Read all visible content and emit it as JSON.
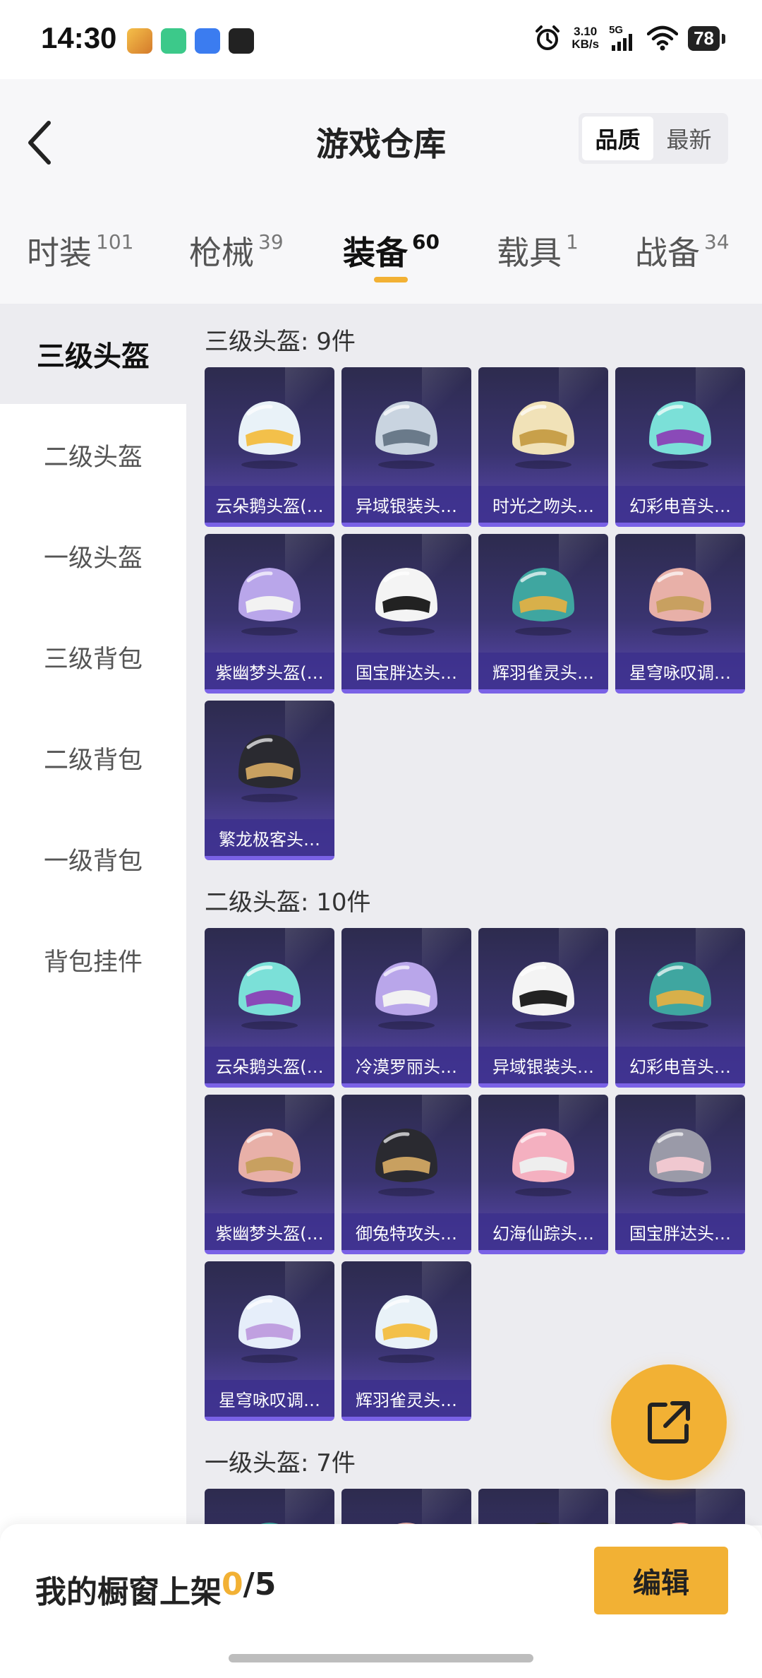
{
  "status_bar": {
    "time": "14:30",
    "net_speed_value": "3.10",
    "net_speed_unit": "KB/s",
    "network": "5G",
    "battery": "78",
    "icons": [
      "alarm-icon",
      "signal-icon",
      "wifi-icon",
      "battery-icon"
    ]
  },
  "header": {
    "title": "游戏仓库",
    "sort_options": [
      "品质",
      "最新"
    ],
    "sort_active": "品质"
  },
  "tabs": [
    {
      "label": "时装",
      "count": "101"
    },
    {
      "label": "枪械",
      "count": "39"
    },
    {
      "label": "装备",
      "count": "60"
    },
    {
      "label": "载具",
      "count": "1"
    },
    {
      "label": "战备",
      "count": "34"
    }
  ],
  "active_tab": "装备",
  "sidebar": {
    "items": [
      "三级头盔",
      "二级头盔",
      "一级头盔",
      "三级背包",
      "二级背包",
      "一级背包",
      "背包挂件"
    ],
    "active": "三级头盔"
  },
  "sections": [
    {
      "title": "三级头盔: 9件",
      "items": [
        "云朵鹅头盔(…",
        "异域银装头…",
        "时光之吻头…",
        "幻彩电音头…",
        "紫幽梦头盔(…",
        "国宝胖达头…",
        "辉羽雀灵头…",
        "星穹咏叹调…",
        "繁龙极客头…"
      ]
    },
    {
      "title": "二级头盔: 10件",
      "items": [
        "云朵鹅头盔(…",
        "冷漠罗丽头…",
        "异域银装头…",
        "幻彩电音头…",
        "紫幽梦头盔(…",
        "御兔特攻头…",
        "幻海仙踪头…",
        "国宝胖达头…",
        "星穹咏叹调…",
        "辉羽雀灵头…"
      ]
    },
    {
      "title": "一级头盔: 7件",
      "items": []
    }
  ],
  "bottom_bar": {
    "label": "我的橱窗上架",
    "current": "0",
    "separator": "/",
    "total": "5",
    "edit_label": "编辑"
  },
  "colors": {
    "accent": "#f2b134",
    "card_top": "#2d2b4e",
    "card_bottom": "#5a48b0",
    "content_bg": "#ececf0"
  }
}
